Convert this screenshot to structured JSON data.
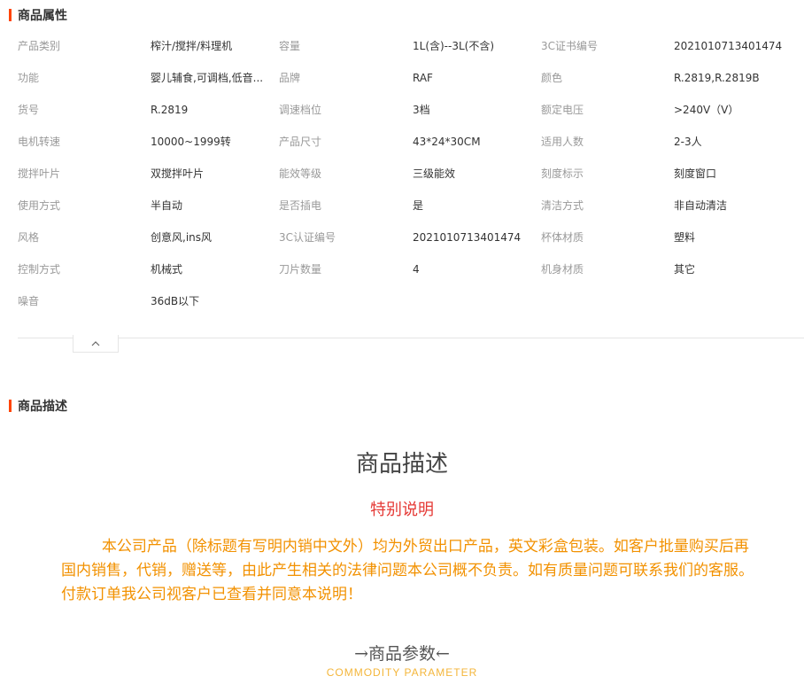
{
  "attributes_section": {
    "title": "商品属性",
    "rows": [
      [
        {
          "label": "产品类别",
          "value": "榨汁/搅拌/料理机"
        },
        {
          "label": "容量",
          "value": "1L(含)--3L(不含)"
        },
        {
          "label": "3C证书编号",
          "value": "2021010713401474"
        }
      ],
      [
        {
          "label": "功能",
          "value": "婴儿辅食,可调档,低音..."
        },
        {
          "label": "品牌",
          "value": "RAF"
        },
        {
          "label": "颜色",
          "value": "R.2819,R.2819B"
        }
      ],
      [
        {
          "label": "货号",
          "value": "R.2819"
        },
        {
          "label": "调速档位",
          "value": "3档"
        },
        {
          "label": "额定电压",
          "value": ">240V（V）"
        }
      ],
      [
        {
          "label": "电机转速",
          "value": "10000~1999转"
        },
        {
          "label": "产品尺寸",
          "value": "43*24*30CM"
        },
        {
          "label": "适用人数",
          "value": "2-3人"
        }
      ],
      [
        {
          "label": "搅拌叶片",
          "value": "双搅拌叶片"
        },
        {
          "label": "能效等级",
          "value": "三级能效"
        },
        {
          "label": "刻度标示",
          "value": "刻度窗口"
        }
      ],
      [
        {
          "label": "使用方式",
          "value": "半自动"
        },
        {
          "label": "是否插电",
          "value": "是"
        },
        {
          "label": "清洁方式",
          "value": "非自动清洁"
        }
      ],
      [
        {
          "label": "风格",
          "value": "创意风,ins风"
        },
        {
          "label": "3C认证编号",
          "value": "2021010713401474"
        },
        {
          "label": "杯体材质",
          "value": "塑料"
        }
      ],
      [
        {
          "label": "控制方式",
          "value": "机械式"
        },
        {
          "label": "刀片数量",
          "value": "4"
        },
        {
          "label": "机身材质",
          "value": "其它"
        }
      ],
      [
        {
          "label": "噪音",
          "value": "36dB以下"
        }
      ]
    ]
  },
  "collapse_icon": "chevron-up-icon",
  "description_section": {
    "title": "商品描述",
    "heading": "商品描述",
    "special_title": "特别说明",
    "notice": "本公司产品（除标题有写明内销中文外）均为外贸出口产品，英文彩盒包装。如客户批量购买后再国内销售，代销，赠送等，由此产生相关的法律问题本公司概不负责。如有质量问题可联系我们的客服。付款订单我公司视客户已查看并同意本说明！",
    "param_title": "→商品参数←",
    "param_subtitle": "COMMODITY  PARAMETER"
  },
  "colors": {
    "accent_bar": "#ff4400",
    "notice_text": "#f29100",
    "special_title": "#e53935",
    "param_subtitle": "#f4b63b"
  }
}
